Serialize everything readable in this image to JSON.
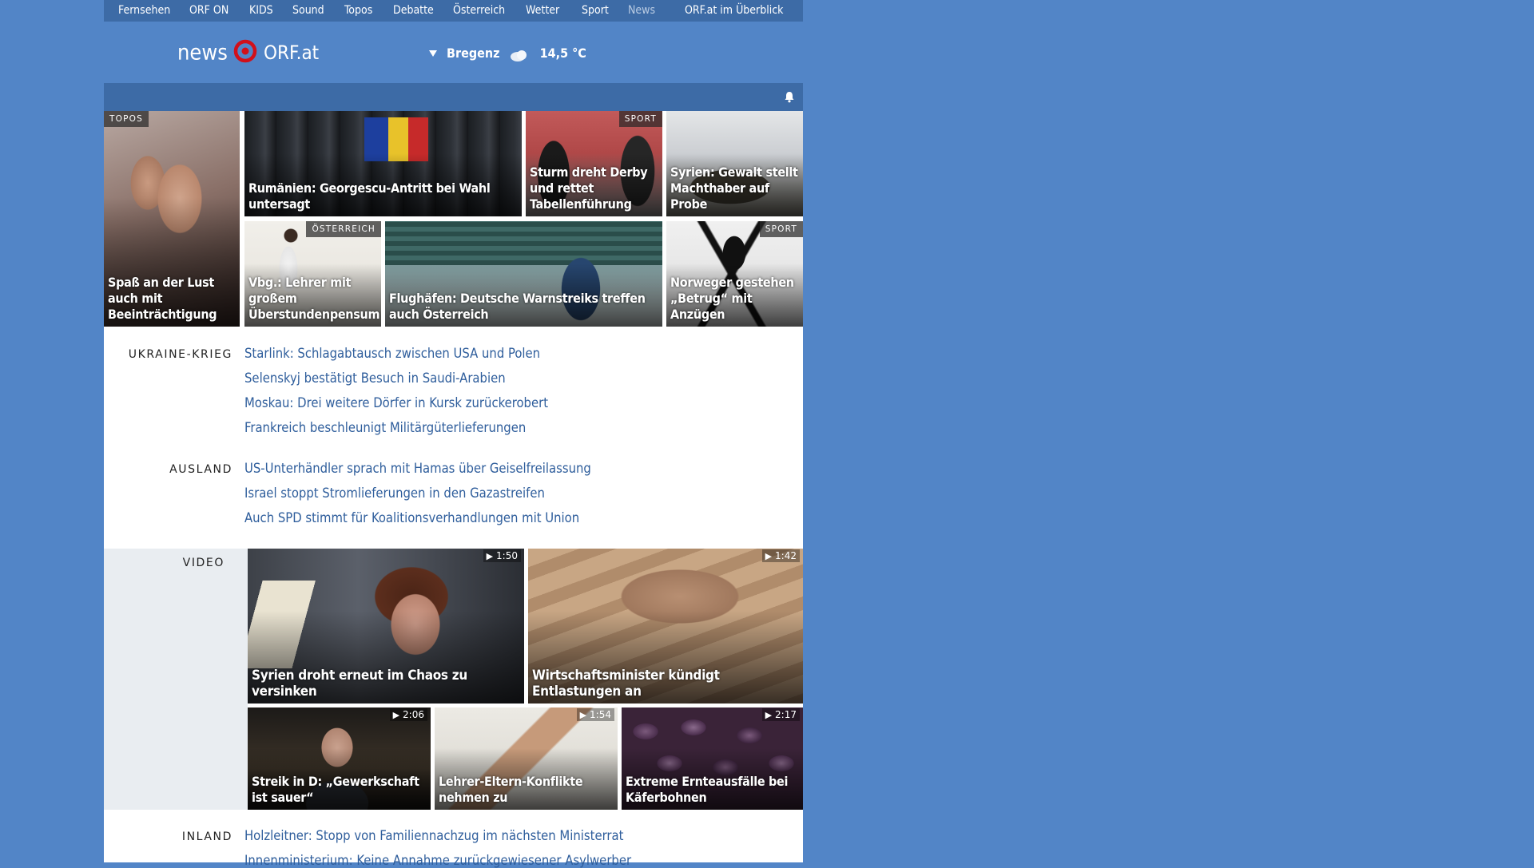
{
  "topnav": {
    "items": [
      {
        "label": "Fernsehen",
        "muted": false
      },
      {
        "label": "ORF ON",
        "muted": false
      },
      {
        "label": "KIDS",
        "muted": false
      },
      {
        "label": "Sound",
        "muted": false
      },
      {
        "label": "Topos",
        "muted": false
      },
      {
        "label": "Debatte",
        "muted": false
      },
      {
        "label": "Österreich",
        "muted": false
      },
      {
        "label": "Wetter",
        "muted": false
      },
      {
        "label": "Sport",
        "muted": false
      },
      {
        "label": "News",
        "muted": true
      },
      {
        "label": "ORF.at im Überblick",
        "muted": false
      }
    ]
  },
  "header": {
    "logo_news": "news",
    "logo_orf": "ORF.at",
    "weather_location": "Bregenz",
    "weather_temp": "14,5 °C",
    "weather_icon": "partly-cloudy-icon"
  },
  "bluebar": {
    "icon": "bell-icon"
  },
  "topstories": [
    {
      "tag": "TOPOS",
      "caption": "Spaß an der Lust auch mit Beeinträchtigung"
    },
    {
      "tag": "",
      "caption": "Rumänien: Georgescu-Antritt bei Wahl untersagt"
    },
    {
      "tag": "SPORT",
      "caption": "Sturm dreht Derby und rettet Tabellenführung"
    },
    {
      "tag": "",
      "caption": "Syrien: Gewalt stellt Machthaber auf Probe"
    },
    {
      "tag": "ÖSTERREICH",
      "caption": "Vbg.: Lehrer mit großem Überstundenpensum"
    },
    {
      "tag": "",
      "caption": "Flughäfen: Deutsche Warnstreiks treffen auch Österreich"
    },
    {
      "tag": "SPORT",
      "caption": "Norweger gestehen „Betrug“ mit Anzügen"
    }
  ],
  "sections": {
    "ukraine": {
      "label": "UKRAINE-KRIEG",
      "headlines": [
        "Starlink: Schlagabtausch zwischen USA und Polen",
        "Selenskyj bestätigt Besuch in Saudi-Arabien",
        "Moskau: Drei weitere Dörfer in Kursk zurückerobert",
        "Frankreich beschleunigt Militärgüterlieferungen"
      ]
    },
    "ausland": {
      "label": "AUSLAND",
      "headlines": [
        "US-Unterhändler sprach mit Hamas über Geiselfreilassung",
        "Israel stoppt Stromlieferungen in den Gazastreifen",
        "Auch SPD stimmt für Koalitionsverhandlungen mit Union"
      ]
    },
    "video": {
      "label": "VIDEO",
      "items": [
        {
          "caption": "Syrien droht erneut im Chaos zu versinken",
          "duration": "1:50"
        },
        {
          "caption": "Wirtschaftsminister kündigt Entlastungen an",
          "duration": "1:42"
        },
        {
          "caption": "Streik in D: „Gewerkschaft ist sauer“",
          "duration": "2:06"
        },
        {
          "caption": "Lehrer-Eltern-Konflikte nehmen zu",
          "duration": "1:54"
        },
        {
          "caption": "Extreme Ernteausfälle bei Käferbohnen",
          "duration": "2:17"
        }
      ]
    },
    "inland": {
      "label": "INLAND",
      "headlines": [
        "Holzleitner: Stopp von Familiennachzug im nächsten Ministerrat",
        "Innenministerium: Keine Annahme zurückgewiesener Asylwerber"
      ]
    }
  },
  "colors": {
    "page_bg": "#5285c7",
    "nav_bg": "#3d6ba6",
    "headline": "#2f5e9c",
    "logo_red": "#d1101a"
  }
}
